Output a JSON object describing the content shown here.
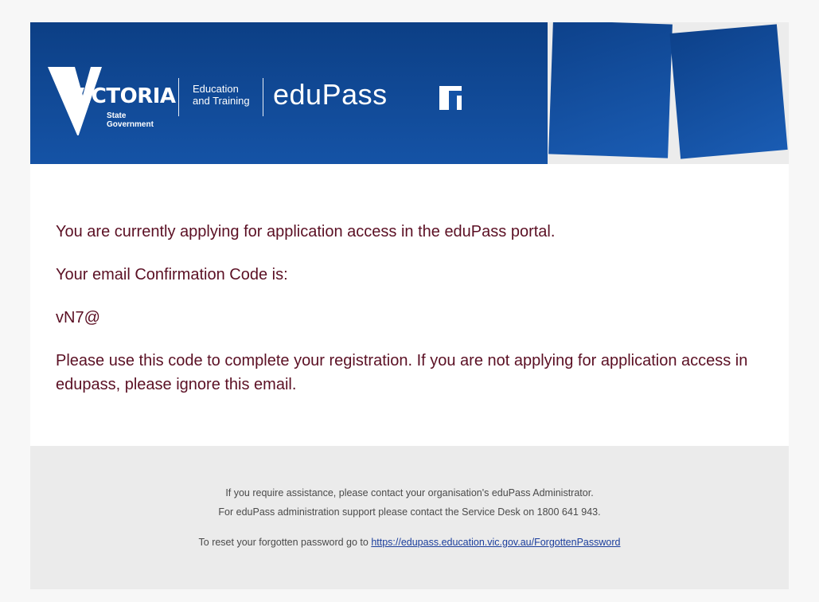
{
  "banner": {
    "state_word": "VICTORIA",
    "state_sub": "State\nGovernment",
    "department": "Education\nand Training",
    "product": "eduPass"
  },
  "message": {
    "line1": "You are currently applying for application access in the eduPass portal.",
    "line2": "Your email Confirmation Code is:",
    "code": "vN7@",
    "line3": "Please use this code to complete your registration. If you are not applying for application access in edupass, please ignore this email."
  },
  "footer": {
    "assist": "If you require assistance, please contact your organisation's eduPass Administrator.",
    "support": "For eduPass administration support please contact the Service Desk on 1800 641 943.",
    "reset_prefix": "To reset your forgotten password go to ",
    "reset_link": "https://edupass.education.vic.gov.au/ForgottenPassword"
  },
  "colors": {
    "banner_blue": "#0c3f85",
    "body_text": "#5b1024",
    "link": "#1b3e9c",
    "footer_bg": "#ebebeb"
  }
}
